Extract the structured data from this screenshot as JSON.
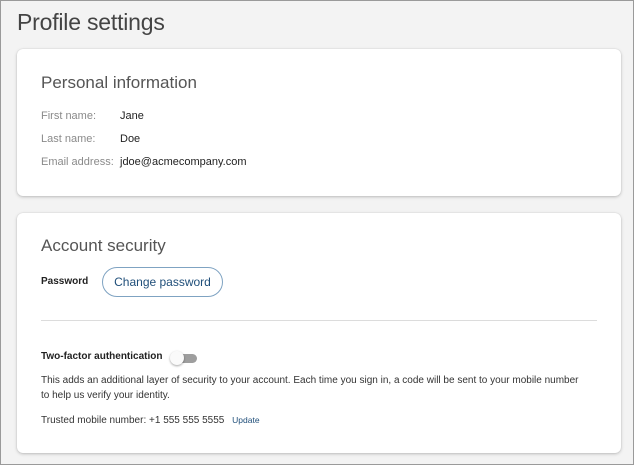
{
  "page": {
    "title": "Profile settings"
  },
  "personal": {
    "title": "Personal information",
    "fields": [
      {
        "label": "First name:",
        "value": "Jane"
      },
      {
        "label": "Last name:",
        "value": "Doe"
      },
      {
        "label": "Email address:",
        "value": "jdoe@acmecompany.com"
      }
    ]
  },
  "security": {
    "title": "Account security",
    "password_label": "Password",
    "change_password_label": "Change password",
    "two_factor": {
      "label": "Two-factor authentication",
      "enabled": false,
      "description": "This adds an additional layer of security to your account. Each time you sign in, a code will be sent to your mobile number to help us verify your identity.",
      "trusted_text": "Trusted mobile number: +1 555 555 5555",
      "update_label": "Update"
    }
  },
  "colors": {
    "accent": "#1f4e79",
    "toggle_off": "#9e9e9e"
  }
}
